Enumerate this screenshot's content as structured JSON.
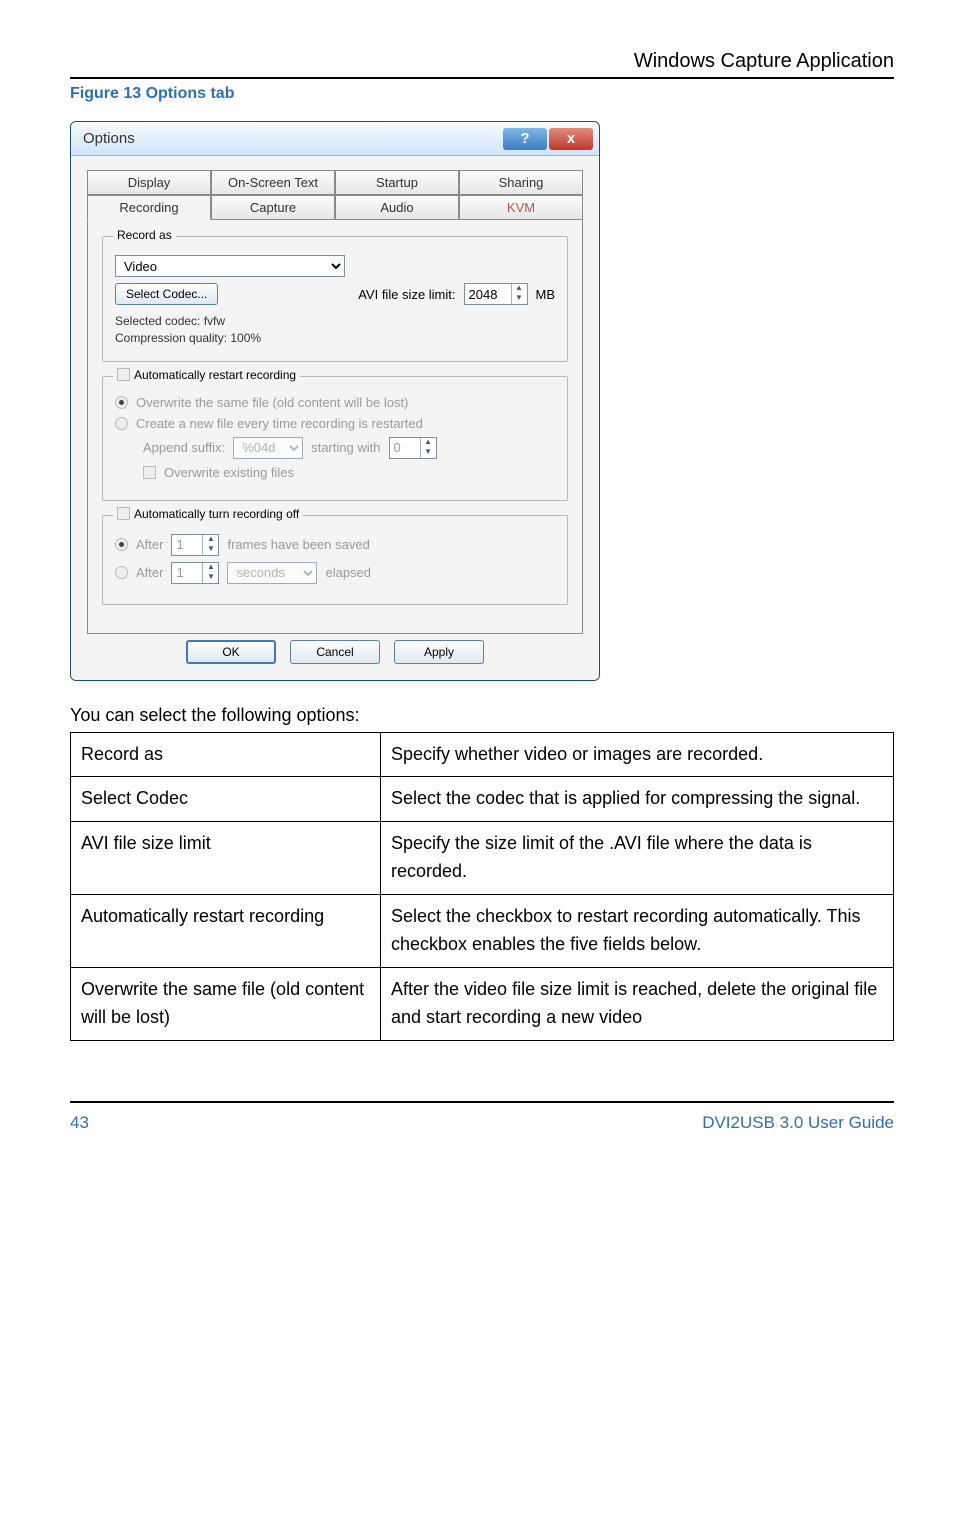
{
  "header": {
    "app_title": "Windows Capture Application"
  },
  "figure_caption": "Figure 13 Options tab",
  "dialog": {
    "title": "Options",
    "tabs_row1": [
      "Display",
      "On-Screen Text",
      "Startup",
      "Sharing"
    ],
    "tabs_row2": [
      "Recording",
      "Capture",
      "Audio",
      "KVM"
    ],
    "record_as": {
      "label": "Record as",
      "value": "Video",
      "select_codec_btn": "Select Codec...",
      "avi_limit_label": "AVI file size limit:",
      "avi_limit_value": "2048",
      "avi_limit_unit": "MB",
      "codec_line1": "Selected codec: fvfw",
      "codec_line2": "Compression quality: 100%"
    },
    "auto_restart": {
      "group_label": "Automatically restart recording",
      "overwrite_label": "Overwrite the same file (old content will be lost)",
      "create_new_label": "Create a new file every time recording is restarted",
      "append_suffix_label": "Append suffix:",
      "append_suffix_value": "%04d",
      "starting_with_label": "starting with",
      "starting_with_value": "0",
      "overwrite_existing_label": "Overwrite existing files"
    },
    "auto_off": {
      "group_label": "Automatically turn recording off",
      "after1_label": "After",
      "after1_value": "1",
      "after1_frames": "frames have been saved",
      "after2_label": "After",
      "after2_value": "1",
      "after2_seconds": "seconds",
      "after2_elapsed": "elapsed"
    },
    "buttons": {
      "ok": "OK",
      "cancel": "Cancel",
      "apply": "Apply"
    }
  },
  "table": {
    "intro": "You can select the following options:",
    "rows": [
      {
        "name": "Record as",
        "desc": "Specify whether video or images are recorded."
      },
      {
        "name": "Select Codec",
        "desc": "Select the codec that is applied for compressing the signal."
      },
      {
        "name": "AVI file size limit",
        "desc": "Specify the size limit of the .AVI file where the data is recorded."
      },
      {
        "name": "Automatically restart recording",
        "desc": "Select the checkbox to restart recording automatically. This checkbox enables the five fields below."
      },
      {
        "name": "Overwrite the same file (old content will be lost)",
        "desc": "After the video file size limit is reached, delete the original file and start recording a new video"
      }
    ]
  },
  "footer": {
    "page": "43",
    "guide": "DVI2USB 3.0  User Guide"
  }
}
